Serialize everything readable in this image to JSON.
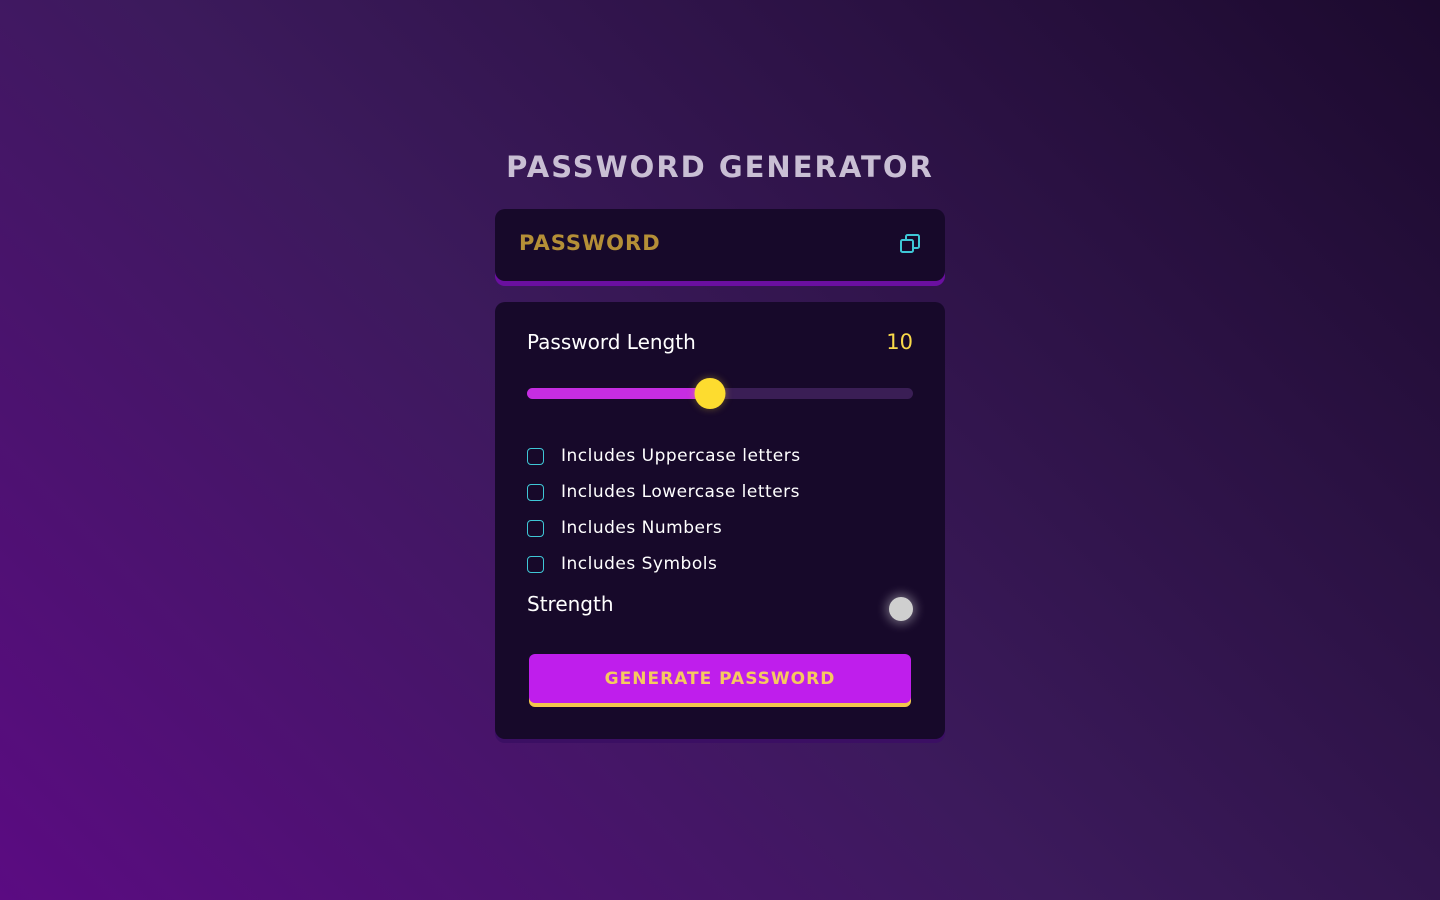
{
  "app": {
    "title": "PASSWORD GENERATOR"
  },
  "display": {
    "password_text": "PASSWORD",
    "copy_icon": "copy-icon"
  },
  "length": {
    "label": "Password Length",
    "value": "10",
    "slider_fill_fraction": 0.475
  },
  "options": [
    {
      "label": "Includes Uppercase letters",
      "checked": false
    },
    {
      "label": "Includes Lowercase letters",
      "checked": false
    },
    {
      "label": "Includes Numbers",
      "checked": false
    },
    {
      "label": "Includes Symbols",
      "checked": false
    }
  ],
  "strength": {
    "label": "Strength",
    "indicator_color": "#cfcfcf"
  },
  "actions": {
    "generate_label": "GENERATE PASSWORD"
  },
  "colors": {
    "accent_purple": "#bf1eec",
    "accent_yellow": "#fddc2f",
    "checkbox_border": "#3fc7d6",
    "panel_bg": "#17092a"
  }
}
